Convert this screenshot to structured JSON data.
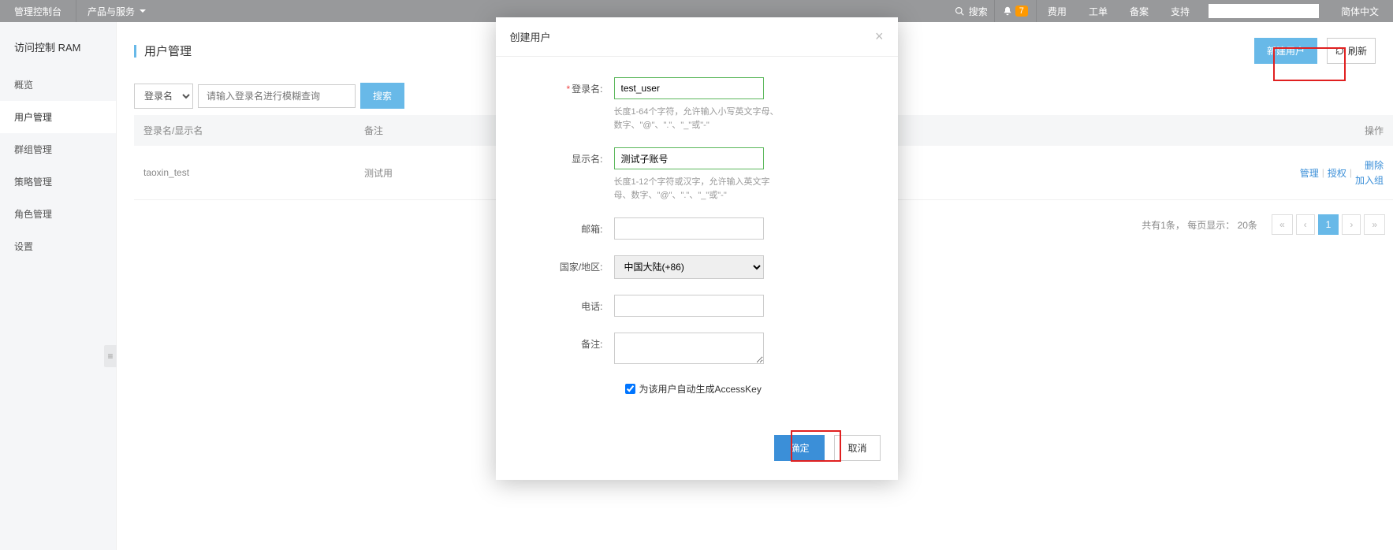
{
  "topnav": {
    "brand": "管理控制台",
    "products": "产品与服务",
    "search_placeholder": "搜索",
    "bell_badge": "7",
    "links": {
      "fee": "费用",
      "ticket": "工单",
      "beian": "备案",
      "support": "支持"
    },
    "language": "简体中文"
  },
  "sidebar": {
    "title": "访问控制 RAM",
    "items": [
      "概览",
      "用户管理",
      "群组管理",
      "策略管理",
      "角色管理",
      "设置"
    ],
    "active_index": 1
  },
  "page": {
    "title": "用户管理",
    "new_user_btn": "新建用户",
    "refresh_btn": "刷新",
    "search_field_option": "登录名",
    "search_placeholder": "请输入登录名进行模糊查询",
    "search_btn": "搜索"
  },
  "table": {
    "headers": {
      "login": "登录名/显示名",
      "remark": "备注",
      "ops": "操作"
    },
    "rows": [
      {
        "login": "taoxin_test",
        "remark": "测试用"
      }
    ],
    "row_actions": {
      "manage": "管理",
      "authorize": "授权",
      "delete": "删除",
      "addgroup": "加入组"
    }
  },
  "pagination": {
    "total_text": "共有1条，",
    "pagesize_text": "每页显示：",
    "pagesize_value": "20条",
    "current": "1"
  },
  "modal": {
    "title": "创建用户",
    "labels": {
      "login": "登录名:",
      "display": "显示名:",
      "email": "邮箱:",
      "region": "国家/地区:",
      "phone": "电话:",
      "remark": "备注:"
    },
    "values": {
      "login": "test_user",
      "display": "测试子账号",
      "region": "中国大陆(+86)"
    },
    "hints": {
      "login": "长度1-64个字符，允许输入小写英文字母、数字、\"@\"、\".\"、\"_\"或\"-\"",
      "display": "长度1-12个字符或汉字，允许输入英文字母、数字、\"@\"、\".\"、\"_\"或\"-\""
    },
    "checkbox_label": "为该用户自动生成AccessKey",
    "ok": "确定",
    "cancel": "取消"
  }
}
